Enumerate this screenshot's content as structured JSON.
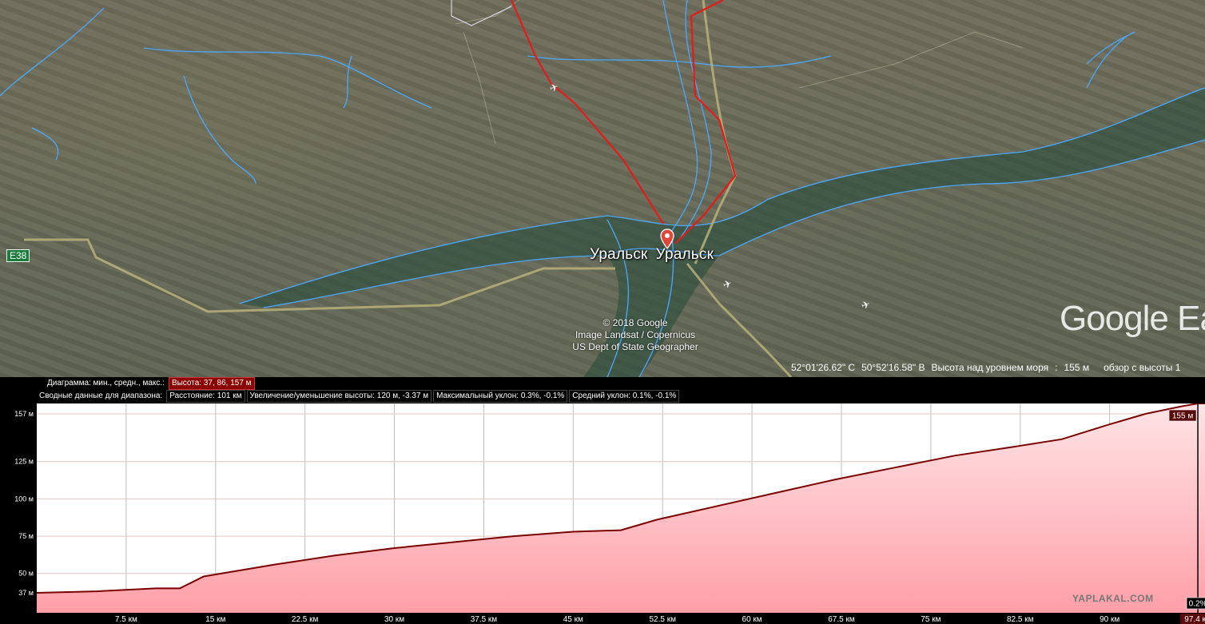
{
  "map": {
    "place_labels": [
      "Уральск",
      "Уральск"
    ],
    "road_badge": "E38",
    "copyright_lines": [
      "© 2018 Google",
      "Image Landsat / Copernicus",
      "US Dept of State Geographer"
    ],
    "watermark": "Google Ea",
    "status": {
      "lat": "52°01'26.62\" С",
      "lon": "50°52'16.58\" В",
      "elev_label": "Высота над уровнем моря",
      "elev_value": "155 м",
      "eye_label": "обзор с высоты 1"
    },
    "colors": {
      "river": "#4aa8ff",
      "route": "#e31b1b",
      "road": "#b8b07a"
    }
  },
  "profile": {
    "row1_label": "Диаграмма: мин., средн., макс.:",
    "row1_value": "Высота: 37, 86, 157 м",
    "row2_label": "Сводные данные для диапазона:",
    "row2_cells": [
      "Расстояние: 101 км",
      "Увеличение/уменьшение высоты: 120 м, -3.37 м",
      "Максимальный уклон: 0.3%, -0.1%",
      "Средний уклон: 0.1%, -0.1%"
    ],
    "cursor_elevation": "155 м",
    "cursor_distance": "97.4 км",
    "cursor_slope": "0.2%",
    "watermark": "YAPLAKAL.COM"
  },
  "chart_data": {
    "type": "area",
    "xlabel": "",
    "ylabel": "",
    "x_unit": "км",
    "y_unit": "м",
    "xlim": [
      0,
      98
    ],
    "ylim": [
      37,
      157
    ],
    "x_ticks": [
      "7.5 км",
      "15 км",
      "22.5 км",
      "30 км",
      "37.5 км",
      "45 км",
      "52.5 км",
      "60 км",
      "67.5 км",
      "75 км",
      "82.5 км",
      "90 км",
      "97.4 км"
    ],
    "x_tick_values": [
      7.5,
      15,
      22.5,
      30,
      37.5,
      45,
      52.5,
      60,
      67.5,
      75,
      82.5,
      90,
      97.4
    ],
    "y_ticks": [
      "157 м",
      "125 м",
      "100 м",
      "75 м",
      "50 м",
      "37 м"
    ],
    "y_tick_values": [
      157,
      125,
      100,
      75,
      50,
      37
    ],
    "series": [
      {
        "x": [
          0,
          5,
          10,
          12,
          14,
          20,
          25,
          30,
          35,
          40,
          45,
          49,
          52,
          57,
          62,
          67,
          72,
          77,
          82,
          86,
          90,
          93,
          96,
          97.4,
          98
        ],
        "y": [
          37,
          38,
          40,
          40,
          48,
          56,
          62,
          67,
          71,
          75,
          78,
          79,
          86,
          95,
          104,
          113,
          121,
          129,
          135,
          140,
          150,
          157,
          162,
          164,
          165
        ]
      }
    ],
    "cursor_x": 97.4,
    "colors": {
      "line": "#7a0000",
      "fill_top": "#ffe4e6",
      "fill_bottom": "#ff9fa8",
      "grid": "#bdbdbd"
    }
  }
}
